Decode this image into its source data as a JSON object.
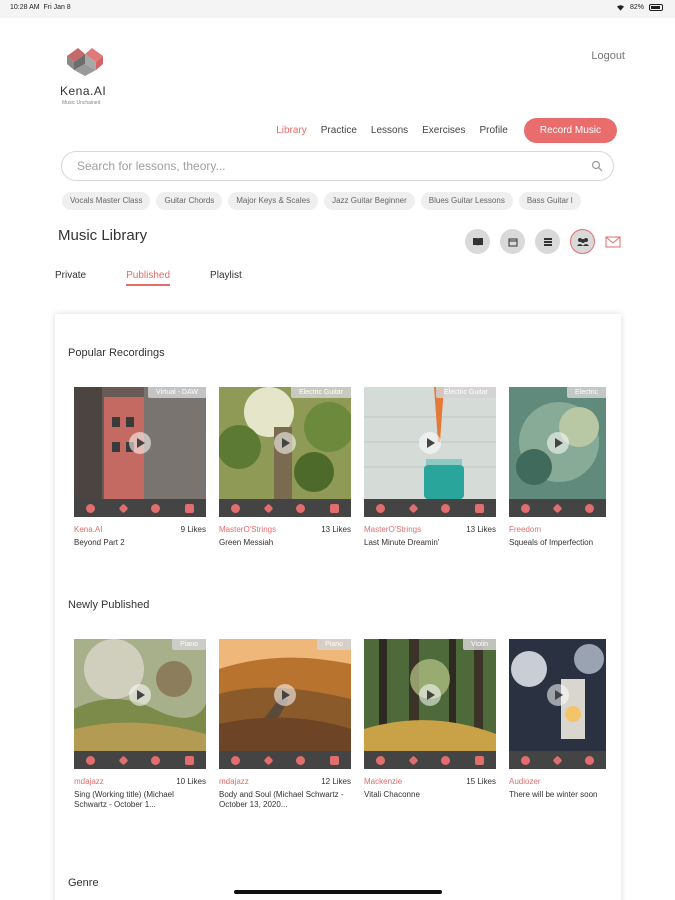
{
  "status": {
    "time": "10:28 AM",
    "date": "Fri Jan 8",
    "battery": "82%"
  },
  "brand": {
    "name": "Kena.AI",
    "tagline": "Music Unchained"
  },
  "header": {
    "logout": "Logout"
  },
  "nav": {
    "items": [
      "Library",
      "Practice",
      "Lessons",
      "Exercises",
      "Profile"
    ],
    "active": "Library",
    "record_label": "Record Music"
  },
  "search": {
    "placeholder": "Search for lessons, theory..."
  },
  "chips": [
    "Vocals Master Class",
    "Guitar Chords",
    "Major Keys & Scales",
    "Jazz Guitar Beginner",
    "Blues Guitar Lessons",
    "Bass Guitar l"
  ],
  "page": {
    "title": "Music Library"
  },
  "tabs": [
    "Private",
    "Published",
    "Playlist"
  ],
  "sections": {
    "popular": {
      "title": "Popular Recordings",
      "cards": [
        {
          "badge": "Virtual - DAW",
          "author": "Kena.AI",
          "likes": "9 Likes",
          "title": "Beyond Part 2"
        },
        {
          "badge": "Electric Guitar",
          "author": "MasterO'Strings",
          "likes": "13 Likes",
          "title": "Green Messiah"
        },
        {
          "badge": "Electric Guitar",
          "author": "MasterO'Strings",
          "likes": "13 Likes",
          "title": "Last Minute Dreamin'"
        },
        {
          "badge": "Electric",
          "author": "Freedom",
          "likes": "",
          "title": "Squeals of Imperfection"
        }
      ]
    },
    "newly": {
      "title": "Newly Published",
      "cards": [
        {
          "badge": "Piano",
          "author": "mdajazz",
          "likes": "10 Likes",
          "title": "Sing (Working title) (Michael Schwartz - October 1..."
        },
        {
          "badge": "Piano",
          "author": "mdajazz",
          "likes": "12 Likes",
          "title": "Body and Soul (Michael Schwartz - October 13, 2020..."
        },
        {
          "badge": "Violin",
          "author": "Mackenzie",
          "likes": "15 Likes",
          "title": "Vitali Chaconne"
        },
        {
          "badge": "",
          "author": "Audiozer",
          "likes": "",
          "title": "There will be winter soon"
        }
      ]
    },
    "genre": {
      "title": "Genre"
    }
  },
  "colors": {
    "accent": "#e96d6d",
    "dark_bar": "#444444"
  },
  "icons": {
    "view": [
      "book-icon",
      "calendar-icon",
      "list-icon",
      "group-icon"
    ],
    "actions": [
      "share-icon",
      "link-icon",
      "add-icon",
      "thumbs-up-icon"
    ]
  }
}
